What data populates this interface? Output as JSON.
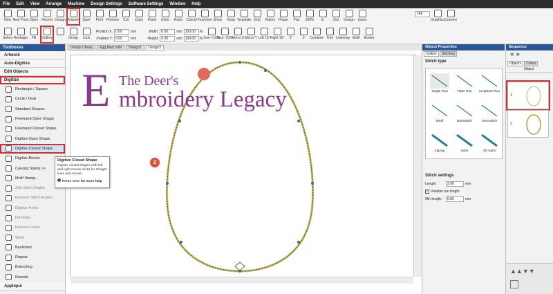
{
  "menu": [
    "File",
    "Edit",
    "View",
    "Arrange",
    "Machine",
    "Design Settings",
    "Software Settings",
    "Window",
    "Help"
  ],
  "ribbon_top": [
    {
      "label": "New",
      "icon": "new-icon"
    },
    {
      "label": "New From",
      "icon": "new-from-icon"
    },
    {
      "label": "Open",
      "icon": "open-icon"
    },
    {
      "label": "Recent",
      "icon": "recent-icon"
    },
    {
      "label": "Design",
      "icon": "design-icon"
    },
    {
      "label": "Artwork",
      "icon": "artwork-icon",
      "highlight": true
    },
    {
      "label": "Save",
      "icon": "save-icon"
    },
    {
      "label": "Print",
      "icon": "print-icon"
    },
    {
      "label": "Preview",
      "icon": "preview-icon"
    },
    {
      "label": "Cut",
      "icon": "cut-icon"
    },
    {
      "label": "Copy",
      "icon": "copy-icon"
    },
    {
      "label": "Paste",
      "icon": "paste-icon"
    },
    {
      "label": "Undo",
      "icon": "undo-icon"
    },
    {
      "label": "Redo",
      "icon": "redo-icon"
    },
    {
      "label": "Cancel",
      "icon": "cancel-icon"
    },
    {
      "label": "TrueView",
      "icon": "trueview-icon"
    },
    {
      "label": "Show",
      "icon": "show-icon"
    },
    {
      "label": "Hoop",
      "icon": "hoop-icon"
    },
    {
      "label": "Template",
      "icon": "template-icon"
    },
    {
      "label": "Grid",
      "icon": "grid-icon"
    },
    {
      "label": "Rulers",
      "icon": "rulers-icon"
    },
    {
      "label": "Player",
      "icon": "player-icon"
    },
    {
      "label": "Pan",
      "icon": "pan-icon"
    },
    {
      "label": "100%",
      "icon": "zoom-100-icon"
    },
    {
      "label": "In",
      "icon": "zoom-in-icon"
    },
    {
      "label": "Out",
      "icon": "zoom-out-icon"
    },
    {
      "label": "Design",
      "icon": "zoom-design-icon"
    },
    {
      "label": "Zoom",
      "icon": "zoom-icon"
    }
  ],
  "ribbon_top_right": [
    {
      "label": "Graphics",
      "icon": "graphics-icon"
    },
    {
      "label": "Convert",
      "icon": "convert-icon"
    }
  ],
  "zoom_value": "146",
  "ribbon_bottom_left": [
    {
      "label": "Select",
      "icon": "select-icon"
    },
    {
      "label": "Reshape",
      "icon": "reshape-icon"
    },
    {
      "label": "Fill",
      "icon": "fill-icon"
    },
    {
      "label": "Outline",
      "icon": "outline-icon",
      "highlight": true
    },
    {
      "label": "",
      "icon": "layers-icon"
    },
    {
      "label": "Group",
      "icon": "group-icon"
    },
    {
      "label": "Lock",
      "icon": "lock-icon"
    }
  ],
  "position": {
    "x_label": "Position X:",
    "x": "0.00",
    "y_label": "Position Y:",
    "y": "0.00",
    "unit": "mm"
  },
  "size": {
    "w_label": "Width:",
    "w": "0.00",
    "h_label": "Height:",
    "h": "0.00",
    "unit": "mm",
    "wp": "100.00",
    "hp": "100.00",
    "pct": "%"
  },
  "ribbon_bottom_right": [
    {
      "label": "Size +10%",
      "icon": "size-up-icon"
    },
    {
      "label": "Size -10%",
      "icon": "size-down-icon"
    },
    {
      "label": "Mirror X",
      "icon": "mirror-x-icon"
    },
    {
      "label": "Mirror Y",
      "icon": "mirror-y-icon"
    },
    {
      "label": "Left 15°",
      "icon": "rotate-left-icon"
    },
    {
      "label": "Right 15°",
      "icon": "rotate-right-icon"
    },
    {
      "label": "0",
      "icon": "angle-icon"
    },
    {
      "label": "0",
      "icon": "skew-icon"
    },
    {
      "label": "Combine",
      "icon": "combine-icon"
    },
    {
      "label": "Trim",
      "icon": "trim-icon"
    },
    {
      "label": "Underlay",
      "icon": "underlay-icon"
    },
    {
      "label": "Motif",
      "icon": "motif-icon"
    },
    {
      "label": "Border",
      "icon": "border-icon"
    }
  ],
  "toolbox": {
    "title": "Toolboxes",
    "sections_top": [
      "Artwork",
      "Auto-Digitize",
      "Edit Objects"
    ],
    "open_section": "Digitize",
    "tools": [
      {
        "label": "Rectangle / Square",
        "icon": "rectangle-icon",
        "dim": false
      },
      {
        "label": "Circle / Oval",
        "icon": "circle-icon",
        "dim": false
      },
      {
        "label": "Standard Shapes",
        "icon": "shapes-icon",
        "dim": false
      },
      {
        "label": "Freehand Open Shape",
        "icon": "freehand-open-icon",
        "dim": false
      },
      {
        "label": "Freehand Closed Shape",
        "icon": "freehand-closed-icon",
        "dim": false
      },
      {
        "label": "Digitize Open Shape",
        "icon": "digitize-open-icon",
        "dim": false
      },
      {
        "label": "Digitize Closed Shape",
        "icon": "digitize-closed-icon",
        "dim": false,
        "selected": true
      },
      {
        "label": "Digitize Blocks",
        "icon": "blocks-icon",
        "dim": false
      },
      {
        "label": "Carving Stamp >>",
        "icon": "carving-stamp-icon",
        "dim": false
      },
      {
        "label": "Motif Stamp...",
        "icon": "motif-stamp-icon",
        "dim": false
      },
      {
        "label": "Add Stitch Angles",
        "icon": "add-angles-icon",
        "dim": true
      },
      {
        "label": "Remove Stitch Angles",
        "icon": "remove-angles-icon",
        "dim": true
      },
      {
        "label": "Digitize Holes",
        "icon": "holes-icon",
        "dim": true
      },
      {
        "label": "Fill Holes",
        "icon": "fill-holes-icon",
        "dim": true
      },
      {
        "label": "Remove Holes",
        "icon": "remove-holes-icon",
        "dim": true
      },
      {
        "label": "Weld",
        "icon": "weld-icon",
        "dim": true
      },
      {
        "label": "Backtrack",
        "icon": "backtrack-icon",
        "dim": false
      },
      {
        "label": "Repeat",
        "icon": "repeat-icon",
        "dim": false
      },
      {
        "label": "Branching",
        "icon": "branching-icon",
        "dim": false
      },
      {
        "label": "Rework",
        "icon": "rework-icon",
        "dim": false
      }
    ],
    "section_bottom": "Appliqué"
  },
  "tooltip": {
    "title": "Digitize Closed Shape",
    "desc": "Digitize closed shapes with left and right mouse clicks for straight lines and curves.",
    "help": "Press <F1> for more help"
  },
  "doc_tabs": [
    "Design Library",
    "Egg Back side",
    "Design2",
    "Design3"
  ],
  "logo": {
    "big": "E",
    "top": "The Deer's",
    "bottom": "mbroidery Legacy"
  },
  "markers": {
    "one": "1",
    "two": "2"
  },
  "props": {
    "title": "Object Properties",
    "tabs": [
      "Outline",
      "Stitching"
    ],
    "stitch_type_label": "Stitch type",
    "stitch_types": [
      "Single Run",
      "Triple Run",
      "Sculpture Run",
      "Motif",
      "Backstitch",
      "Stemstitch",
      "Zigzag",
      "Satin",
      "3D Satin"
    ],
    "settings_label": "Stitch settings",
    "length_label": "Length:",
    "length_value": "2.00",
    "variable_label": "Variable run length",
    "min_label": "Min length:",
    "min_value": "0.80",
    "unit": "mm"
  },
  "sequence": {
    "title": "Sequence",
    "tabs": [
      "Objects",
      "Colors"
    ],
    "column": "Object",
    "rows": [
      "1",
      "2"
    ]
  },
  "colors": {
    "accent": "#2b5797",
    "highlight": "#d32f2f",
    "logo": "#8a3a8e",
    "badge": "#e04e3c",
    "egg_stitch": "#c8b850"
  }
}
